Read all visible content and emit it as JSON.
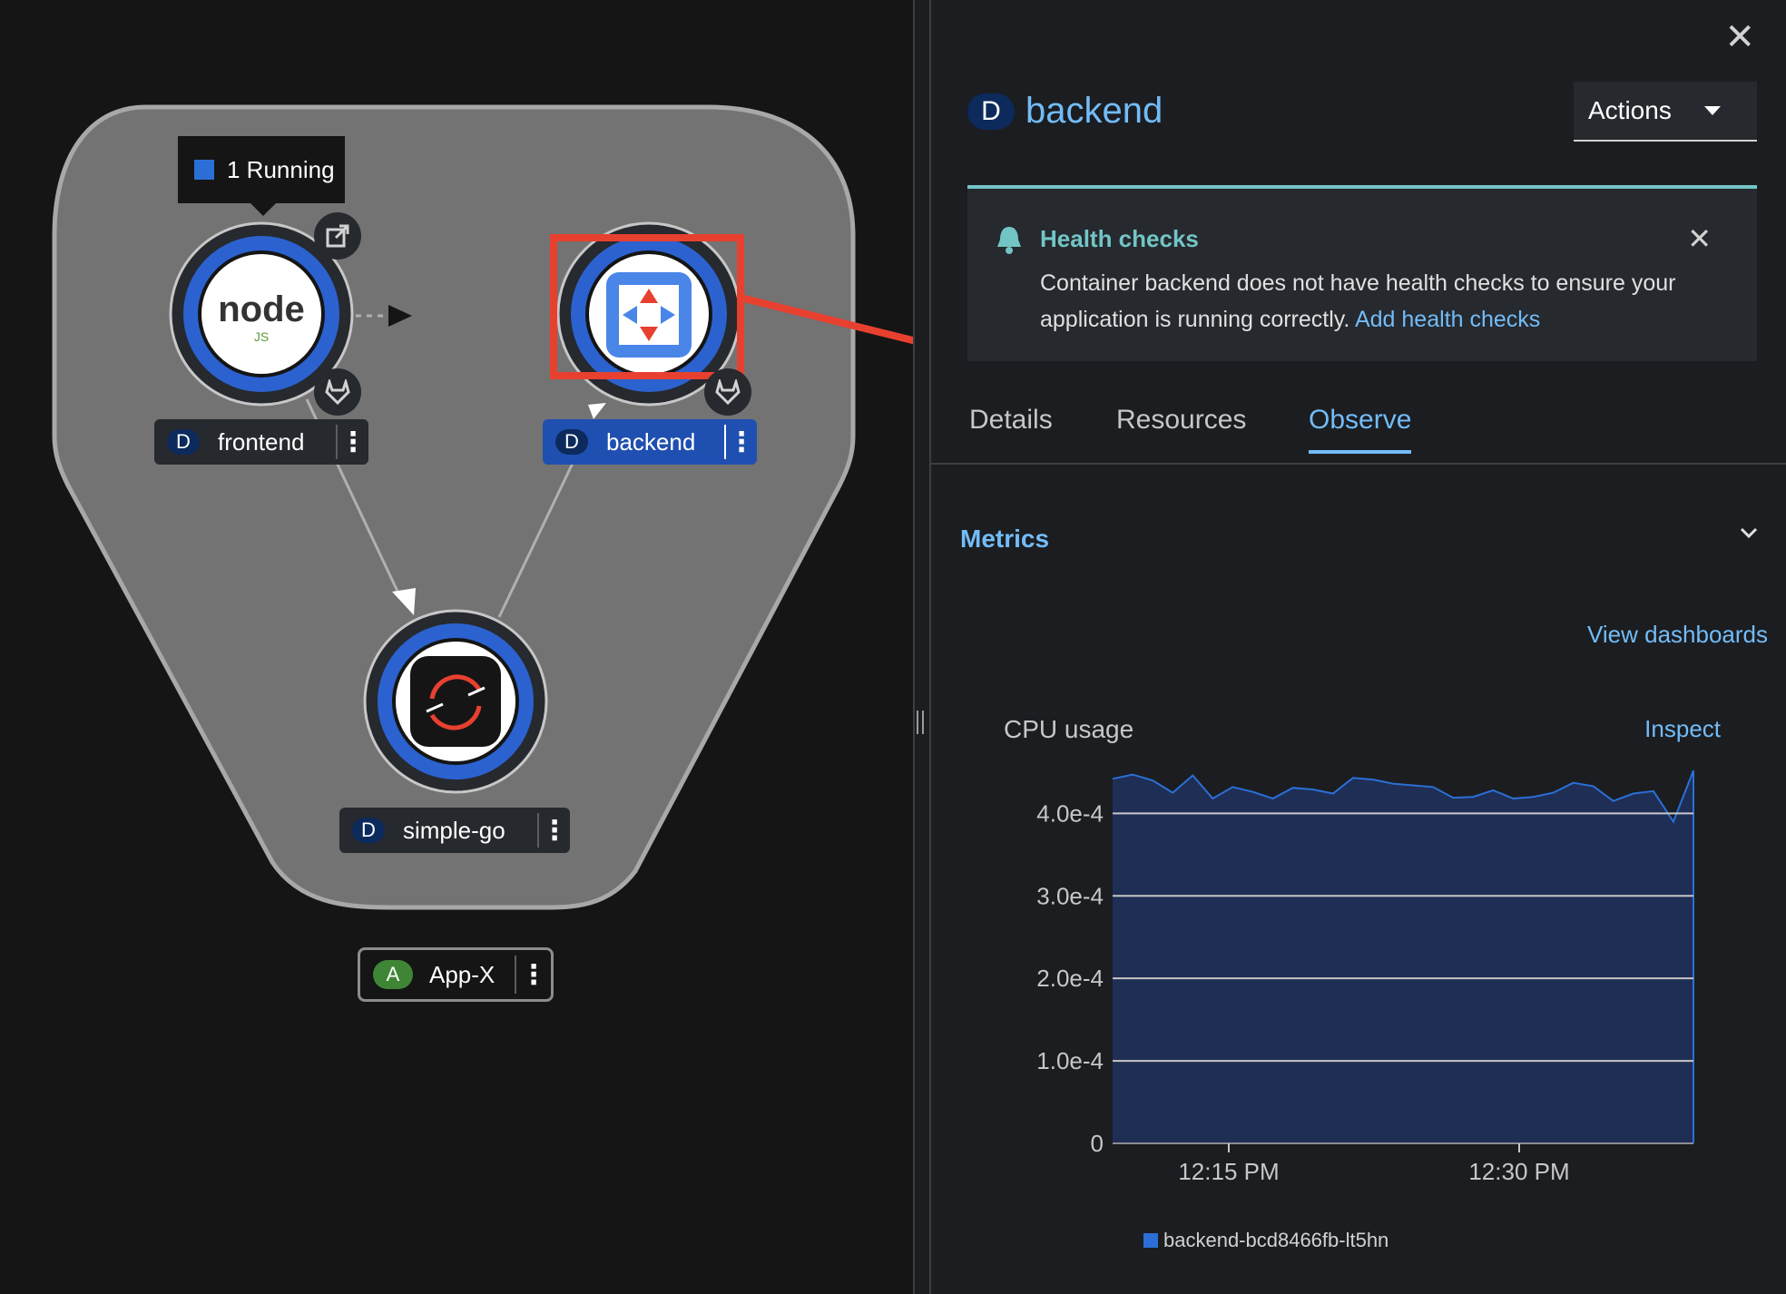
{
  "topology": {
    "tooltip_text": "1 Running",
    "nodes": [
      {
        "kind_badge": "D",
        "name": "frontend",
        "icon": "nodejs-logo"
      },
      {
        "kind_badge": "D",
        "name": "backend",
        "icon": "quarkus-logo"
      },
      {
        "kind_badge": "D",
        "name": "simple-go",
        "icon": "openshift-logo"
      }
    ],
    "application": {
      "badge": "A",
      "name": "App-X"
    }
  },
  "panel": {
    "kind_badge": "D",
    "title": "backend",
    "actions_label": "Actions",
    "alert": {
      "title": "Health checks",
      "body": "Container backend does not have health checks to ensure your application is running correctly.",
      "link": "Add health checks"
    },
    "tabs": [
      {
        "label": "Details"
      },
      {
        "label": "Resources"
      },
      {
        "label": "Observe",
        "active": true
      }
    ],
    "metrics_heading": "Metrics",
    "view_dashboards": "View dashboards",
    "cpu_title": "CPU usage",
    "inspect": "Inspect",
    "legend": "backend-bcd8466fb-lt5hn"
  },
  "colors": {
    "accent": "#73bcf7",
    "node_ring": "#2b62cf",
    "alert_accent": "#73c5c5",
    "annotation_red": "#e8402f"
  },
  "chart_data": {
    "type": "area",
    "series": [
      {
        "name": "backend-bcd8466fb-lt5hn",
        "values": [
          0.000442,
          0.000447,
          0.00044,
          0.000425,
          0.000446,
          0.000418,
          0.000432,
          0.000426,
          0.000418,
          0.000431,
          0.000429,
          0.000424,
          0.000443,
          0.000441,
          0.000436,
          0.000434,
          0.000432,
          0.000419,
          0.00042,
          0.000428,
          0.000418,
          0.00042,
          0.000425,
          0.000437,
          0.000433,
          0.000415,
          0.000424,
          0.000427,
          0.00039,
          0.000452
        ]
      }
    ],
    "x_ticks": [
      "12:15 PM",
      "12:30 PM"
    ],
    "y_ticks": [
      "0",
      "1.0e-4",
      "2.0e-4",
      "3.0e-4",
      "4.0e-4"
    ],
    "ylim": [
      0,
      0.00044
    ],
    "grid": true,
    "legend_position": "bottom"
  }
}
